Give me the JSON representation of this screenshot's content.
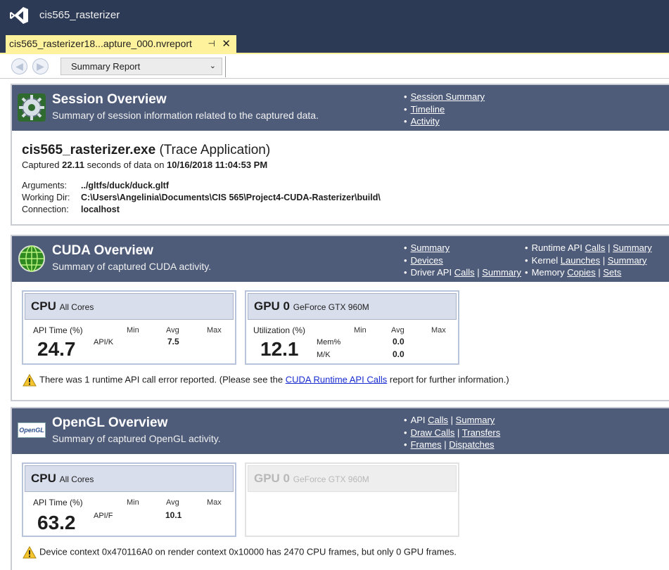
{
  "window": {
    "title": "cis565_rasterizer"
  },
  "doc_tab": {
    "label": "cis565_rasterizer18...apture_000.nvreport",
    "pin": "⊣",
    "close": "✕"
  },
  "toolbar": {
    "back": "◀",
    "forward": "▶",
    "report_select": "Summary Report",
    "caret": "⌄"
  },
  "session": {
    "title": "Session Overview",
    "subtitle": "Summary of session information related to the captured data.",
    "links": [
      "Session Summary",
      "Timeline",
      "Activity"
    ],
    "process": "cis565_rasterizer.exe",
    "process_kind": "(Trace Application)",
    "captured_prefix": "Captured",
    "captured_seconds": "22.11",
    "captured_mid": "seconds of data on",
    "captured_date": "10/16/2018 11:04:53 PM",
    "arguments_label": "Arguments:",
    "arguments": "../gltfs/duck/duck.gltf",
    "working_dir_label": "Working Dir:",
    "working_dir": "C:\\Users\\Angelinia\\Documents\\CIS 565\\Project4-CUDA-Rasterizer\\build\\",
    "connection_label": "Connection:",
    "connection": "localhost"
  },
  "cuda": {
    "title": "CUDA Overview",
    "subtitle": "Summary of captured CUDA activity.",
    "links_left": {
      "summary": "Summary",
      "devices": "Devices",
      "driver_prefix": "Driver API",
      "driver_calls": "Calls",
      "sep": "|",
      "driver_summary": "Summary"
    },
    "links_right": {
      "runtime_prefix": "Runtime API",
      "runtime_calls": "Calls",
      "runtime_summary": "Summary",
      "kernel_prefix": "Kernel",
      "kernel_launches": "Launches",
      "kernel_summary": "Summary",
      "memory_prefix": "Memory",
      "memory_copies": "Copies",
      "memory_sets": "Sets"
    },
    "cpu": {
      "name": "CPU",
      "detail": "All Cores",
      "metric": "API Time (%)",
      "value": "24.7",
      "min": "Min",
      "avg": "Avg",
      "max": "Max",
      "row": "API/K",
      "row_avg": "7.5"
    },
    "gpu": {
      "name": "GPU 0",
      "detail": "GeForce GTX 960M",
      "metric": "Utilization (%)",
      "value": "12.1",
      "min": "Min",
      "avg": "Avg",
      "max": "Max",
      "row1": "Mem%",
      "row1_avg": "0.0",
      "row2": "M/K",
      "row2_avg": "0.0"
    },
    "warning_pre": "There was 1 runtime API call error reported. (Please see the",
    "warning_link": "CUDA Runtime API Calls",
    "warning_post": "report for further information.)"
  },
  "opengl": {
    "title": "OpenGL Overview",
    "subtitle": "Summary of captured OpenGL activity.",
    "icon_text": "OpenGL",
    "links": {
      "api_prefix": "API",
      "api_calls": "Calls",
      "api_summary": "Summary",
      "draw_calls": "Draw Calls",
      "transfers": "Transfers",
      "frames": "Frames",
      "dispatches": "Dispatches"
    },
    "cpu": {
      "name": "CPU",
      "detail": "All Cores",
      "metric": "API Time (%)",
      "value": "63.2",
      "min": "Min",
      "avg": "Avg",
      "max": "Max",
      "row": "API/F",
      "row_avg": "10.1"
    },
    "gpu": {
      "name": "GPU 0",
      "detail": "GeForce GTX 960M"
    },
    "warning": "Device context 0x470116A0 on render context 0x10000 has 2470 CPU frames, but only 0 GPU frames."
  },
  "colors": {
    "titlebar": "#2d3a55",
    "section_header": "#4e5c7a",
    "tab": "#fff29d",
    "card_header": "#d8deec",
    "link": "#1a2dd0"
  }
}
